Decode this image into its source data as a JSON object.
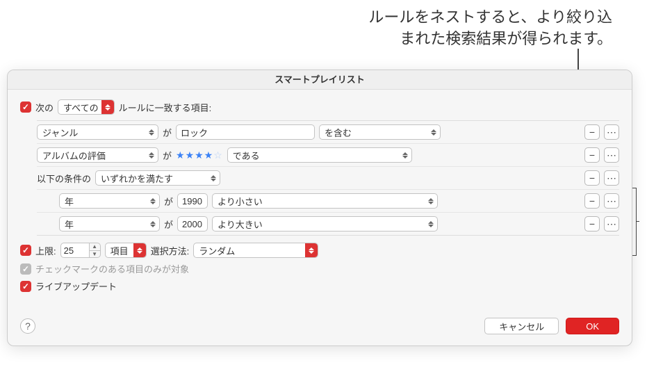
{
  "annotation": {
    "line1": "ルールをネストすると、より絞り込",
    "line2": "まれた検索結果が得られます。"
  },
  "window": {
    "title": "スマートプレイリスト"
  },
  "match": {
    "prefix": "次の",
    "scope": "すべての",
    "suffix": "ルールに一致する項目:"
  },
  "rules": [
    {
      "field": "ジャンル",
      "conn": "が",
      "value": "ロック",
      "cond": "を含む"
    },
    {
      "field": "アルバムの評価",
      "conn": "が",
      "stars": 4,
      "cond": "である"
    },
    {
      "groupLabel": "以下の条件の",
      "groupMode": "いずれかを満たす"
    },
    {
      "field": "年",
      "conn": "が",
      "value": "1990",
      "cond": "より小さい",
      "nested": true
    },
    {
      "field": "年",
      "conn": "が",
      "value": "2000",
      "cond": "より大きい",
      "nested": true
    }
  ],
  "limit": {
    "label": "上限:",
    "value": "25",
    "unit": "項目",
    "methodLabel": "選択方法:",
    "method": "ランダム"
  },
  "checkedOnly": "チェックマークのある項目のみが対象",
  "liveUpdate": "ライブアップデート",
  "buttons": {
    "cancel": "キャンセル",
    "ok": "OK"
  }
}
